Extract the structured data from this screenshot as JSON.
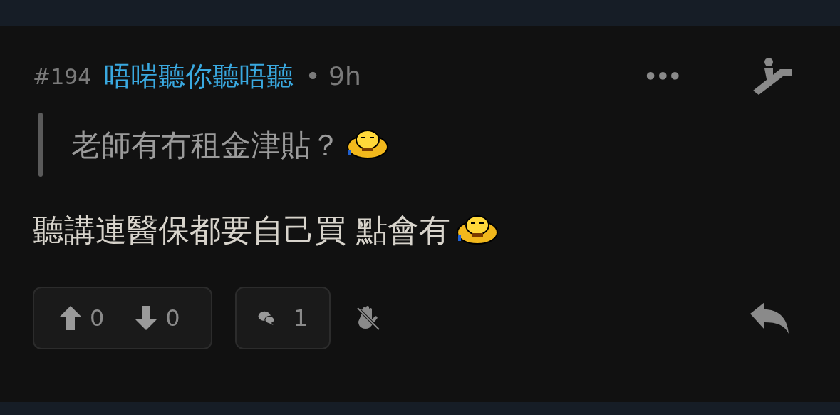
{
  "post": {
    "number": "#194",
    "username": "唔啱聽你聽唔聽",
    "time": "• 9h",
    "more": "•••",
    "quote": "老師有冇租金津貼？",
    "body": "聽講連醫保都要自己買 點會有",
    "upvotes": "0",
    "downvotes": "0",
    "replies": "1"
  }
}
